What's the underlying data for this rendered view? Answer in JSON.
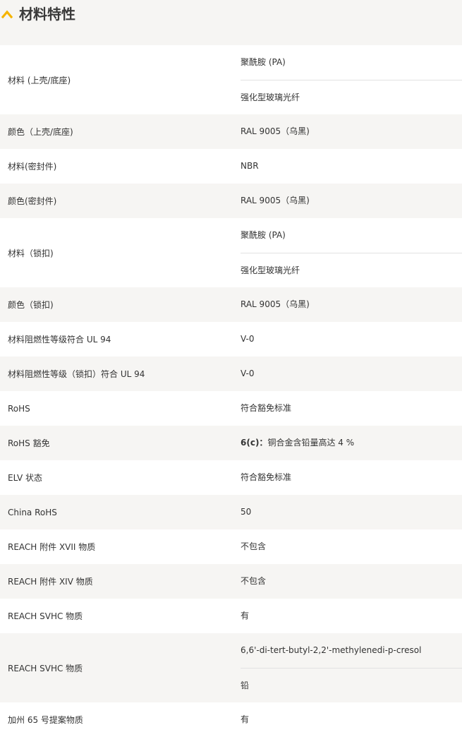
{
  "header": {
    "title": "材料特性"
  },
  "rows": [
    {
      "label": "材料 (上壳/底座)",
      "values": [
        "聚酰胺 (PA)",
        "强化型玻璃光纤"
      ]
    },
    {
      "label": "颜色（上壳/底座)",
      "values": [
        "RAL 9005（乌黑)"
      ]
    },
    {
      "label": "材料(密封件)",
      "values": [
        "NBR"
      ]
    },
    {
      "label": "颜色(密封件)",
      "values": [
        "RAL 9005（乌黑)"
      ]
    },
    {
      "label": "材料（锁扣)",
      "values": [
        "聚酰胺 (PA)",
        "强化型玻璃光纤"
      ]
    },
    {
      "label": "颜色（锁扣)",
      "values": [
        "RAL 9005（乌黑)"
      ]
    },
    {
      "label": "材料阻燃性等级符合 UL 94",
      "values": [
        "V-0"
      ]
    },
    {
      "label": "材料阻燃性等级（锁扣）符合 UL 94",
      "values": [
        "V-0"
      ]
    },
    {
      "label": "RoHS",
      "values": [
        "符合豁免标准"
      ]
    },
    {
      "label": "RoHS 豁免",
      "values": [
        {
          "bold": "6(c)：",
          "text": "铜合金含铅量高达 4 %"
        }
      ]
    },
    {
      "label": "ELV 状态",
      "values": [
        "符合豁免标准"
      ]
    },
    {
      "label": "China RoHS",
      "values": [
        "50"
      ]
    },
    {
      "label": "REACH 附件 XVII 物质",
      "values": [
        "不包含"
      ]
    },
    {
      "label": "REACH 附件 XIV 物质",
      "values": [
        "不包含"
      ]
    },
    {
      "label": "REACH SVHC 物质",
      "values": [
        "有"
      ]
    },
    {
      "label": "REACH SVHC 物质",
      "values": [
        "6,6'-di-tert-butyl-2,2'-methylenedi-p-cresol",
        "铅"
      ]
    },
    {
      "label": "加州 65 号提案物质",
      "values": [
        "有"
      ]
    }
  ]
}
